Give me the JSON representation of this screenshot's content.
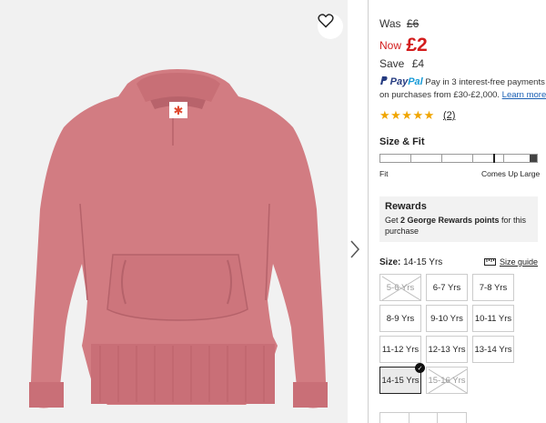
{
  "product": {
    "image": {
      "name": "pink-oversized-hoodie",
      "hoodie_color": "#d27c82",
      "tag_symbol": "✱"
    },
    "wishlist_icon": "heart-icon",
    "next_icon": "chevron-right-icon"
  },
  "pricing": {
    "was_label": "Was",
    "was_price": "£6",
    "now_label": "Now",
    "now_price": "£2",
    "save_label": "Save",
    "save_amount": "£4"
  },
  "paypal": {
    "logo_pay": "Pay",
    "logo_pal": "Pal",
    "line1": "Pay in 3 interest-free payments",
    "line2": "on purchases from £30-£2,000.",
    "link": "Learn more"
  },
  "rating": {
    "stars": "★★★★★",
    "value": 5,
    "count": "(2)"
  },
  "size_fit": {
    "title": "Size & Fit",
    "left_label": "Fit",
    "right_label": "Comes Up Large",
    "marker_position": 0.72
  },
  "rewards": {
    "title": "Rewards",
    "body_prefix": "Get ",
    "body_bold": "2 George Rewards points",
    "body_suffix": " for this purchase"
  },
  "size": {
    "label": "Size:",
    "selected": "14-15 Yrs",
    "guide": "Size guide",
    "options": [
      {
        "label": "5-6 Yrs",
        "available": false
      },
      {
        "label": "6-7 Yrs",
        "available": true
      },
      {
        "label": "7-8 Yrs",
        "available": true
      },
      {
        "label": "8-9 Yrs",
        "available": true
      },
      {
        "label": "9-10 Yrs",
        "available": true
      },
      {
        "label": "10-11 Yrs",
        "available": true
      },
      {
        "label": "11-12 Yrs",
        "available": true
      },
      {
        "label": "12-13 Yrs",
        "available": true
      },
      {
        "label": "13-14 Yrs",
        "available": true
      },
      {
        "label": "14-15 Yrs",
        "available": true,
        "selected": true
      },
      {
        "label": "15-16 Yrs",
        "available": false
      }
    ]
  },
  "colors": {
    "sale_red": "#d31c1c",
    "star_gold": "#f0a500",
    "paypal_blue": "#253b80",
    "paypal_light": "#179bd7",
    "link_blue": "#1a5fb4"
  }
}
